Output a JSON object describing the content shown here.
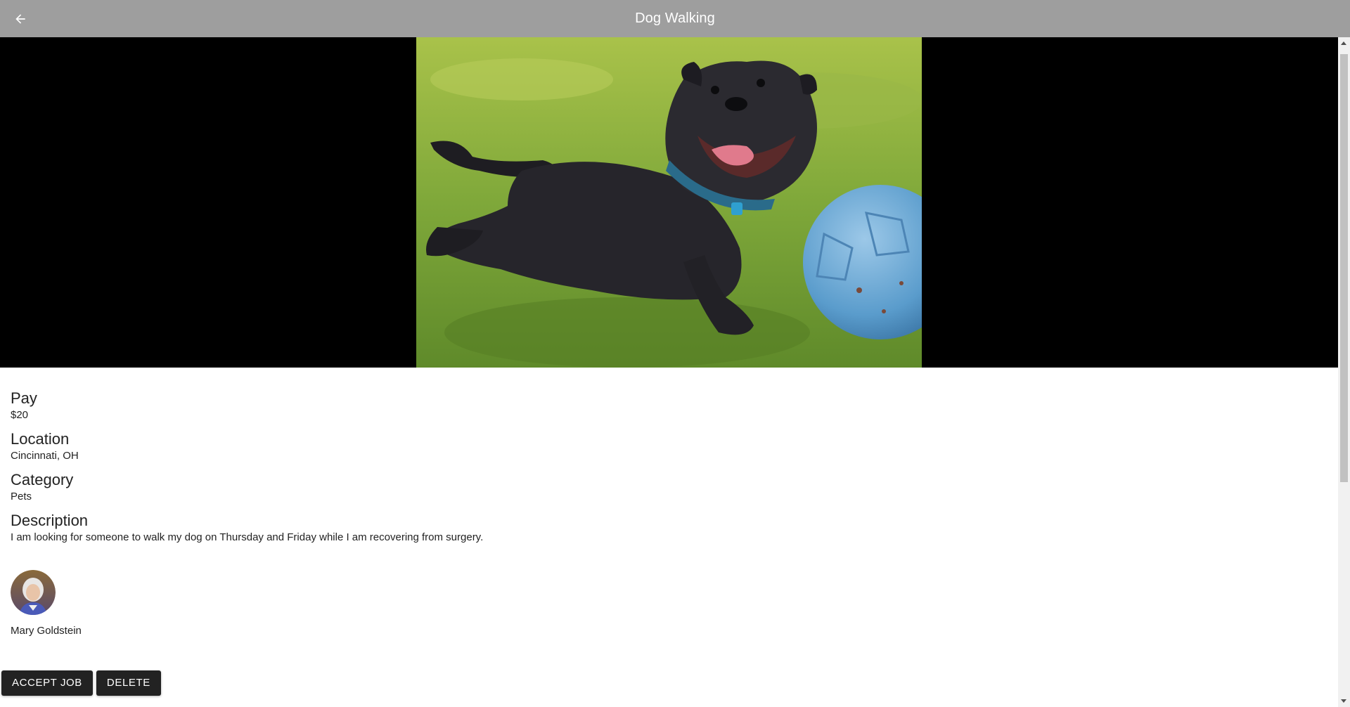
{
  "header": {
    "title": "Dog Walking",
    "back_icon": "arrow-left-icon"
  },
  "colors": {
    "topbar": "#9e9e9e",
    "button_bg": "#222222",
    "hero_bg": "#000000"
  },
  "job": {
    "fields": [
      {
        "label": "Pay",
        "value": "$20"
      },
      {
        "label": "Location",
        "value": "Cincinnati, OH"
      },
      {
        "label": "Category",
        "value": "Pets"
      },
      {
        "label": "Description",
        "value": "I am looking for someone to walk my dog on Thursday and Friday while I am recovering from surgery."
      }
    ],
    "poster": {
      "name": "Mary Goldstein"
    }
  },
  "actions": {
    "accept_label": "ACCEPT JOB",
    "delete_label": "DELETE"
  }
}
